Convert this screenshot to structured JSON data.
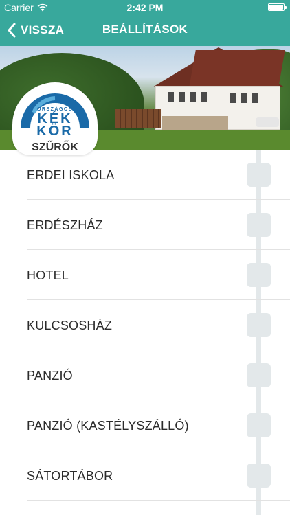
{
  "status_bar": {
    "carrier": "Carrier",
    "time": "2:42 PM",
    "wifi_icon": "wifi-icon",
    "battery_icon": "battery-icon"
  },
  "nav": {
    "back_label": "VISSZA",
    "back_icon": "chevron-left-icon",
    "title": "BEÁLLÍTÁSOK"
  },
  "logo": {
    "top_text": "ORSZÁGOS",
    "line1": "KÉK",
    "line2": "KÖR",
    "filters_label": "SZŰRŐK"
  },
  "filters": [
    {
      "label": "ERDEI ISKOLA",
      "checked": false
    },
    {
      "label": "ERDÉSZHÁZ",
      "checked": false
    },
    {
      "label": "HOTEL",
      "checked": false
    },
    {
      "label": "KULCSOSHÁZ",
      "checked": false
    },
    {
      "label": "PANZIÓ",
      "checked": false
    },
    {
      "label": "PANZIÓ (KASTÉLYSZÁLLÓ)",
      "checked": false
    },
    {
      "label": "SÁTORTÁBOR",
      "checked": false
    }
  ],
  "colors": {
    "header": "#38a89c",
    "logo_blue": "#1a6aa8",
    "checkbox": "#e3e8ea"
  }
}
